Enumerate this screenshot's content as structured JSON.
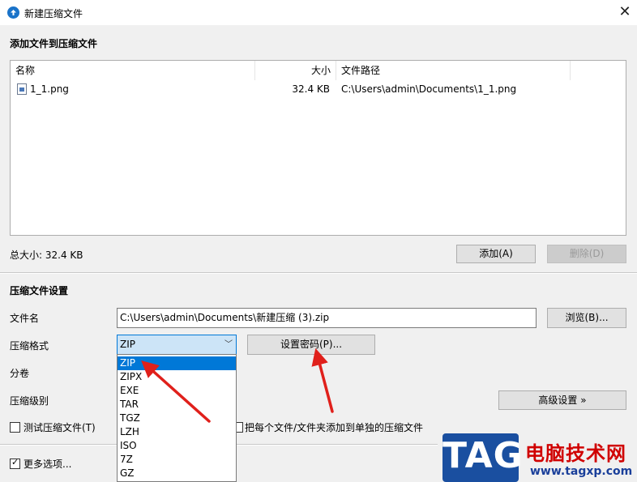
{
  "window": {
    "title": "新建压缩文件",
    "close_glyph": "✕"
  },
  "files_section": {
    "heading": "添加文件到压缩文件",
    "columns": [
      "名称",
      "大小",
      "文件路径"
    ],
    "rows": [
      {
        "name": "1_1.png",
        "size": "32.4 KB",
        "path": "C:\\Users\\admin\\Documents\\1_1.png",
        "icon": "image-file-icon"
      }
    ],
    "total_label": "总大小: 32.4 KB",
    "add_button": "添加(A)",
    "delete_button": "删除(D)"
  },
  "settings": {
    "heading": "压缩文件设置",
    "filename_label": "文件名",
    "filename_value": "C:\\Users\\admin\\Documents\\新建压缩 (3).zip",
    "browse_button": "浏览(B)...",
    "format_label": "压缩格式",
    "format_value": "ZIP",
    "format_options": [
      "ZIP",
      "ZIPX",
      "EXE",
      "TAR",
      "TGZ",
      "LZH",
      "ISO",
      "7Z",
      "GZ"
    ],
    "password_button": "设置密码(P)...",
    "split_label": "分卷",
    "level_label": "压缩级别",
    "advanced_button": "高级设置 »",
    "test_checkbox_label": "测试压缩文件(T)",
    "test_checked": false,
    "separate_checkbox_label": "把每个文件/文件夹添加到单独的压缩文件",
    "separate_checked": false,
    "more_options_label": "更多选项...",
    "more_options_checked": true
  },
  "watermark": {
    "logo_text": "TAG",
    "site_name": "电脑技术网",
    "url": "www.tagxp.com"
  },
  "colors": {
    "accent": "#0078d7",
    "arrow": "#e0201b",
    "logo_bg": "#1a4fa0"
  }
}
